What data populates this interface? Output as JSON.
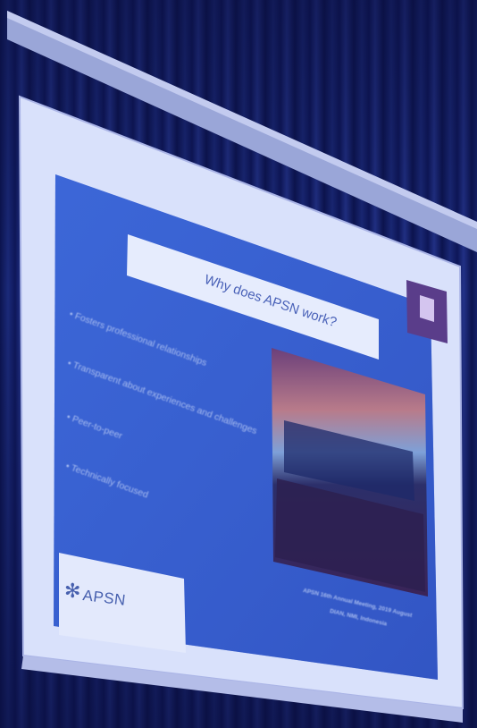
{
  "slide": {
    "title": "Why does APSN work?",
    "bullets": [
      "Fosters professional relationships",
      "Transparent about experiences and challenges",
      "Peer-to-peer",
      "Technically focused"
    ],
    "logo_text": "APSN",
    "photo_caption_line1": "APSN 16th Annual Meeting, 2019 August",
    "photo_caption_line2": "DIAN, NMI, Indonesia"
  },
  "colors": {
    "curtain": "#101a55",
    "screen_frame": "#dfe6ff",
    "slide_bg": "#3b64d6",
    "title_band": "#e8eeff"
  }
}
